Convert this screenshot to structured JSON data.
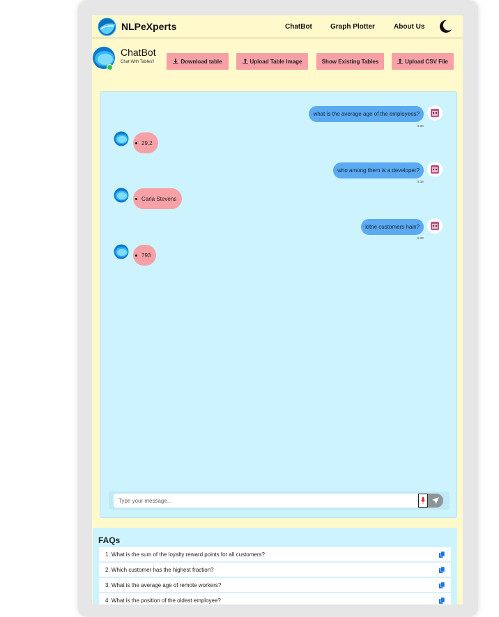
{
  "brand": {
    "name": "NLPeXperts"
  },
  "nav": {
    "items": [
      "ChatBot",
      "Graph Plotter",
      "About Us"
    ]
  },
  "bot": {
    "title": "ChatBot",
    "subtitle": "Chat With Tables!!"
  },
  "actions": [
    "Download table",
    "Upload Table Image",
    "Show Existing Tables",
    "Upload CSV File"
  ],
  "messages": [
    {
      "role": "user",
      "text": "what is the average age of the employees?",
      "time": "5:34"
    },
    {
      "role": "bot",
      "text": "29.2"
    },
    {
      "role": "user",
      "text": "who among them is a developer?",
      "time": "5:34"
    },
    {
      "role": "bot",
      "text": "Carla Stevens"
    },
    {
      "role": "user",
      "text": "kitne customers hain?",
      "time": "5:34"
    },
    {
      "role": "bot",
      "text": "793"
    }
  ],
  "composer": {
    "placeholder": "Type your message..."
  },
  "faq": {
    "title": "FAQs",
    "items": [
      "1. What is the sum of the loyalty reward points for all customers?",
      "2. Which customer has the highest fraction?",
      "3. What is the average age of remote workers?",
      "4. What is the position of the oldest employee?"
    ]
  },
  "colors": {
    "page_bg": "#fff9cc",
    "chat_bg": "#cdf3fe",
    "user_bubble": "#5baaf1",
    "bot_bubble": "#f7a1a7",
    "button": "#f7a1a7",
    "online": "#36c23d"
  },
  "icons": {
    "brand": "logo-icon",
    "theme": "moon-icon",
    "download": "download-icon",
    "upload": "upload-icon",
    "mic": "microphone-icon",
    "send": "send-icon",
    "copy": "copy-icon"
  }
}
